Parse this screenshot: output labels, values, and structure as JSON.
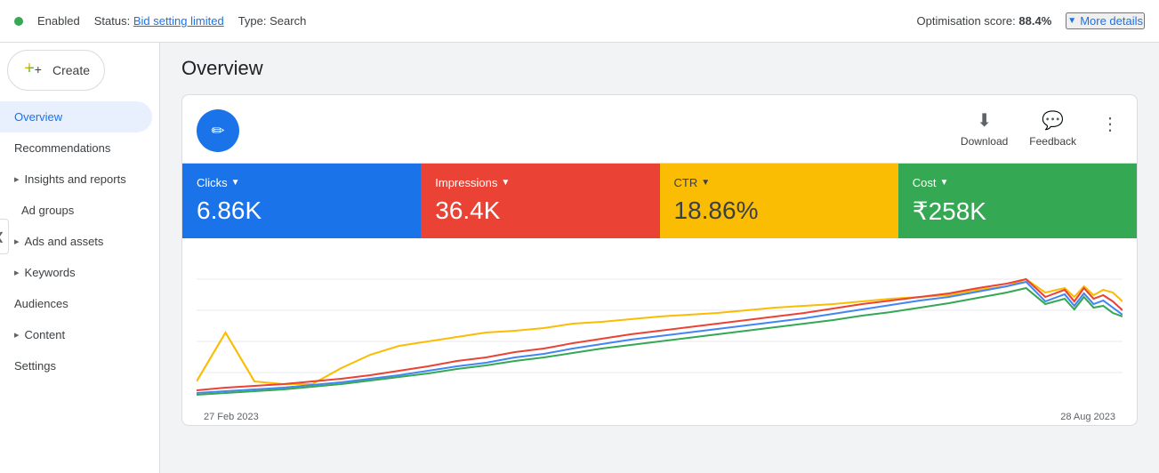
{
  "topbar": {
    "enabled_label": "Enabled",
    "status_label": "Status:",
    "status_value": "Bid setting limited",
    "type_label": "Type:",
    "type_value": "Search",
    "opt_score_label": "Optimisation score:",
    "opt_score_value": "88.4%",
    "more_details_label": "More details"
  },
  "sidebar": {
    "create_label": "Create",
    "items": [
      {
        "label": "Overview",
        "active": true,
        "arrow": false,
        "indent": false
      },
      {
        "label": "Recommendations",
        "active": false,
        "arrow": false,
        "indent": false
      },
      {
        "label": "Insights and reports",
        "active": false,
        "arrow": true,
        "indent": false
      },
      {
        "label": "Ad groups",
        "active": false,
        "arrow": false,
        "indent": true
      },
      {
        "label": "Ads and assets",
        "active": false,
        "arrow": true,
        "indent": false
      },
      {
        "label": "Keywords",
        "active": false,
        "arrow": true,
        "indent": false
      },
      {
        "label": "Audiences",
        "active": false,
        "arrow": false,
        "indent": false
      },
      {
        "label": "Content",
        "active": false,
        "arrow": true,
        "indent": false
      },
      {
        "label": "Settings",
        "active": false,
        "arrow": false,
        "indent": false
      }
    ]
  },
  "page": {
    "title": "Overview"
  },
  "actions": {
    "download_label": "Download",
    "feedback_label": "Feedback"
  },
  "metrics": [
    {
      "label": "Clicks",
      "value": "6.86K",
      "color": "blue"
    },
    {
      "label": "Impressions",
      "value": "36.4K",
      "color": "red"
    },
    {
      "label": "CTR",
      "value": "18.86%",
      "color": "yellow"
    },
    {
      "label": "Cost",
      "value": "₹258K",
      "color": "green"
    }
  ],
  "chart": {
    "date_start": "27 Feb 2023",
    "date_end": "28 Aug 2023"
  }
}
